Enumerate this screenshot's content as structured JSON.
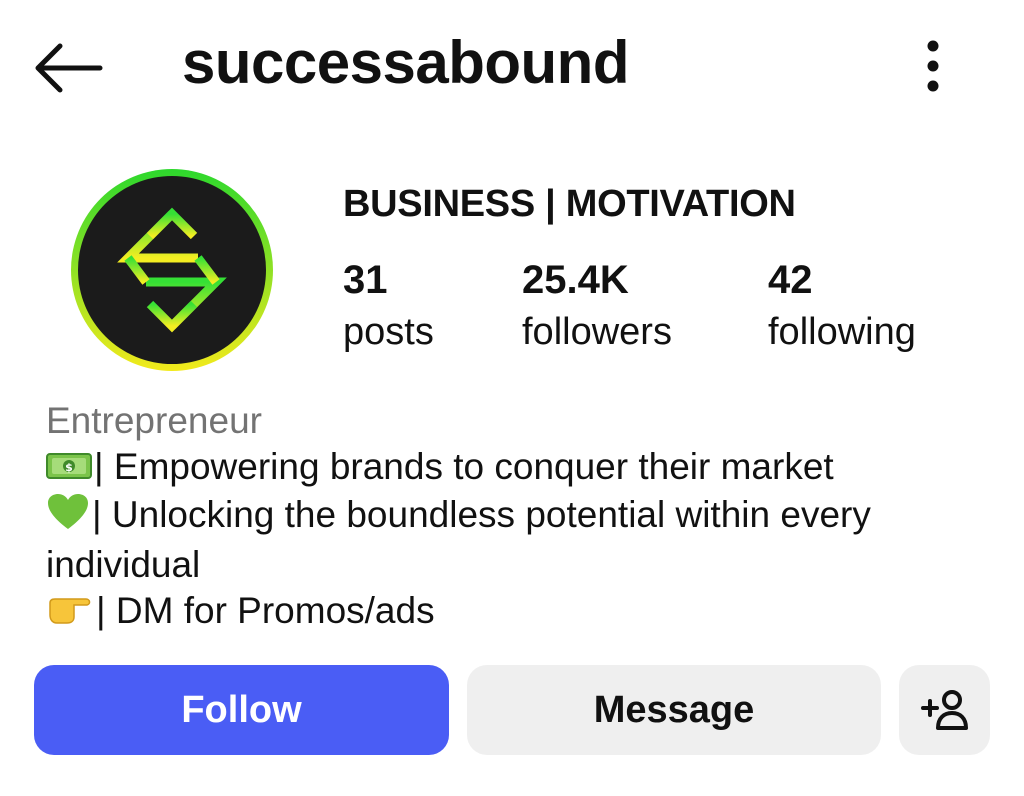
{
  "header": {
    "username": "successabound",
    "back_icon": "arrow-left-icon",
    "menu_icon": "more-vertical-icon"
  },
  "profile": {
    "category": "BUSINESS | MOTIVATION",
    "stats": [
      {
        "value": "31",
        "label": "posts"
      },
      {
        "value": "25.4K",
        "label": "followers"
      },
      {
        "value": "42",
        "label": "following"
      }
    ]
  },
  "bio": {
    "title": "Entrepreneur",
    "line1": "| Empowering brands to conquer their market",
    "line2": "| Unlocking the boundless potential within every individual",
    "line3": "| DM for Promos/ads",
    "line1_icon": "money-icon",
    "line2_icon": "green-heart-icon",
    "line3_icon": "pointing-hand-icon"
  },
  "actions": {
    "follow_label": "Follow",
    "message_label": "Message",
    "add_user_icon": "add-person-icon"
  },
  "colors": {
    "follow_button": "#4a5df5",
    "secondary_button": "#efefef",
    "muted_text": "#737373",
    "avatar_ring_top": "#2dd82d",
    "avatar_ring_bottom": "#f2ea1c"
  }
}
